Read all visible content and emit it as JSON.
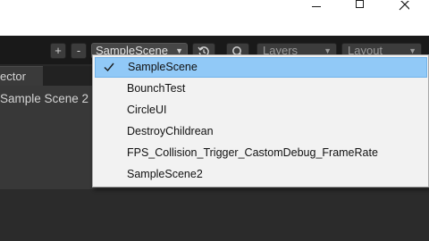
{
  "toolbar": {
    "add_label": "+",
    "remove_label": "-",
    "scene_selector": "SampleScene",
    "layers_label": "Layers",
    "layout_label": "Layout"
  },
  "inspector": {
    "tab_label": "ector",
    "scene_title": "Sample Scene 2"
  },
  "menu": {
    "items": [
      {
        "label": "SampleScene",
        "checked": true
      },
      {
        "label": "BounchTest"
      },
      {
        "label": "CircleUI"
      },
      {
        "label": "DestroyChildrean"
      },
      {
        "label": "FPS_Collision_Trigger_CastomDebug_FrameRate"
      },
      {
        "label": "SampleScene2"
      }
    ]
  },
  "colors": {
    "menu_highlight": "#91c9f7",
    "menu_background": "#f2f2f2",
    "panel": "#383838",
    "toolbar": "#191919"
  }
}
